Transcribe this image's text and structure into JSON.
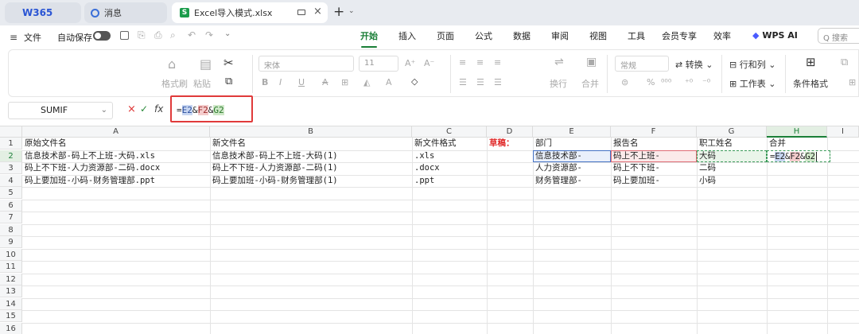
{
  "tabs": [
    {
      "label": "W365",
      "kind": "logo"
    },
    {
      "label": "消息"
    },
    {
      "label": "Excel导入模式.xlsx",
      "active": true
    }
  ],
  "menubar": {
    "menu_label": "文件",
    "autosave_label": "自动保存",
    "tabs": [
      "开始",
      "插入",
      "页面",
      "公式",
      "数据",
      "审阅",
      "视图",
      "工具",
      "会员专享",
      "效率"
    ],
    "active_tab": "开始",
    "wps_ai": "WPS AI",
    "search_placeholder": "Q 搜索"
  },
  "ribbon": {
    "format_painter": "格式刷",
    "paste": "粘贴",
    "font_name": "宋体",
    "font_size": "11",
    "number_format": "常规",
    "convert": "转换",
    "rows_cols": "行和列",
    "worksheet": "工作表",
    "cond_format": "条件格式",
    "wrap": "换行",
    "merge": "合并"
  },
  "formula_bar": {
    "name_box": "SUMIF",
    "formula_prefix": "=",
    "ref1": "E2",
    "amp1": "&",
    "ref2": "F2",
    "amp2": "&",
    "ref3": "G2"
  },
  "columns": [
    "A",
    "B",
    "C",
    "D",
    "E",
    "F",
    "G",
    "H",
    "I"
  ],
  "active_column": "H",
  "rows": [
    "1",
    "2",
    "3",
    "4",
    "5",
    "6",
    "7",
    "8",
    "9",
    "10",
    "11",
    "12",
    "13",
    "14",
    "15",
    "16"
  ],
  "active_row": "2",
  "cells": {
    "A1": "原始文件名",
    "B1": "新文件名",
    "C1": "新文件格式",
    "D1": "草稿：",
    "E1": "部门",
    "F1": "报告名",
    "G1": "职工姓名",
    "H1": "合并",
    "A2": "信息技术部-码上不上班-大码.xls",
    "B2": "信息技术部-码上不上班-大码(1)",
    "C2": ".xls",
    "E2": "信息技术部-",
    "F2": "码上不上班-",
    "G2": "大码",
    "A3": "码上不下班-人力资源部-二码.docx",
    "B3": "码上不下班-人力资源部-二码(1)",
    "C3": ".docx",
    "E3": "人力资源部-",
    "F3": "码上不下班-",
    "G3": "二码",
    "A4": "码上要加班-小码-财务管理部.ppt",
    "B4": "码上要加班-小码-财务管理部(1)",
    "C4": ".ppt",
    "E4": "财务管理部-",
    "F4": "码上要加班-",
    "G4": "小码"
  },
  "editing_cell": {
    "prefix": "=",
    "ref1": "E2",
    "amp1": "&",
    "ref2": "F2",
    "amp2": "&",
    "ref3": "G2"
  },
  "colors": {
    "accent": "#1a7f37",
    "ref_blue": "#4472c4",
    "ref_red": "#e06c75",
    "ref_green": "#3c9b5a",
    "draft_red": "#e02b2b",
    "highlight_box": "#e03a3a"
  }
}
